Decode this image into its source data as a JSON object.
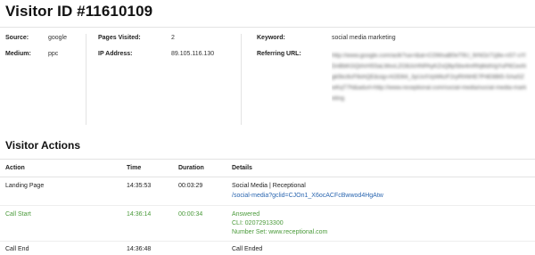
{
  "page": {
    "title": "Visitor ID #11610109"
  },
  "info": {
    "source_label": "Source:",
    "source_value": "google",
    "medium_label": "Medium:",
    "medium_value": "ppc",
    "pages_label": "Pages Visited:",
    "pages_value": "2",
    "ip_label": "IP Address:",
    "ip_value": "89.105.116.130",
    "keyword_label": "Keyword:",
    "keyword_value": "social media marketing",
    "referring_label": "Referring URL:",
    "referring_value_redacted": "http://www.google.com/aclk?sa=l&ai=COWxaB0eT9U_9rNOz71j6e-nS7-sYlDnBbKGQtArH5SaLMxvLZO8JcHNPAyKZsQ6pSbx4mRhjtkldVgYuP6CexNgk5kc6cF8xhQE&sig=AOD64_3yUxXVpWkzF2ryRhNHE7P4E6Bt5-SAaSZwKqT7N&adurl=http://www.receptional.com/social-media/social-media-marketing"
  },
  "actions": {
    "section_title": "Visitor Actions",
    "headers": {
      "action": "Action",
      "time": "Time",
      "duration": "Duration",
      "details": "Details"
    },
    "rows": [
      {
        "action": "Landing Page",
        "time": "14:35:53",
        "duration": "00:03:29",
        "details": [
          "Social Media | Receptional"
        ],
        "link": "/social-media?gclid=CJOn1_X6ocACFcBwwod4HgAtw"
      },
      {
        "action": "Call Start",
        "time": "14:36:14",
        "duration": "00:00:34",
        "details": [
          "Answered",
          "CLI: 02072913300",
          "Number Set: www.receptional.com"
        ]
      },
      {
        "action": "Call End",
        "time": "14:36:48",
        "duration": "",
        "details": [
          "Call Ended"
        ]
      }
    ]
  },
  "colors": {
    "green_text": "#4a9a3a",
    "link_blue": "#2a66b0",
    "divider": "#e3e3e3"
  }
}
